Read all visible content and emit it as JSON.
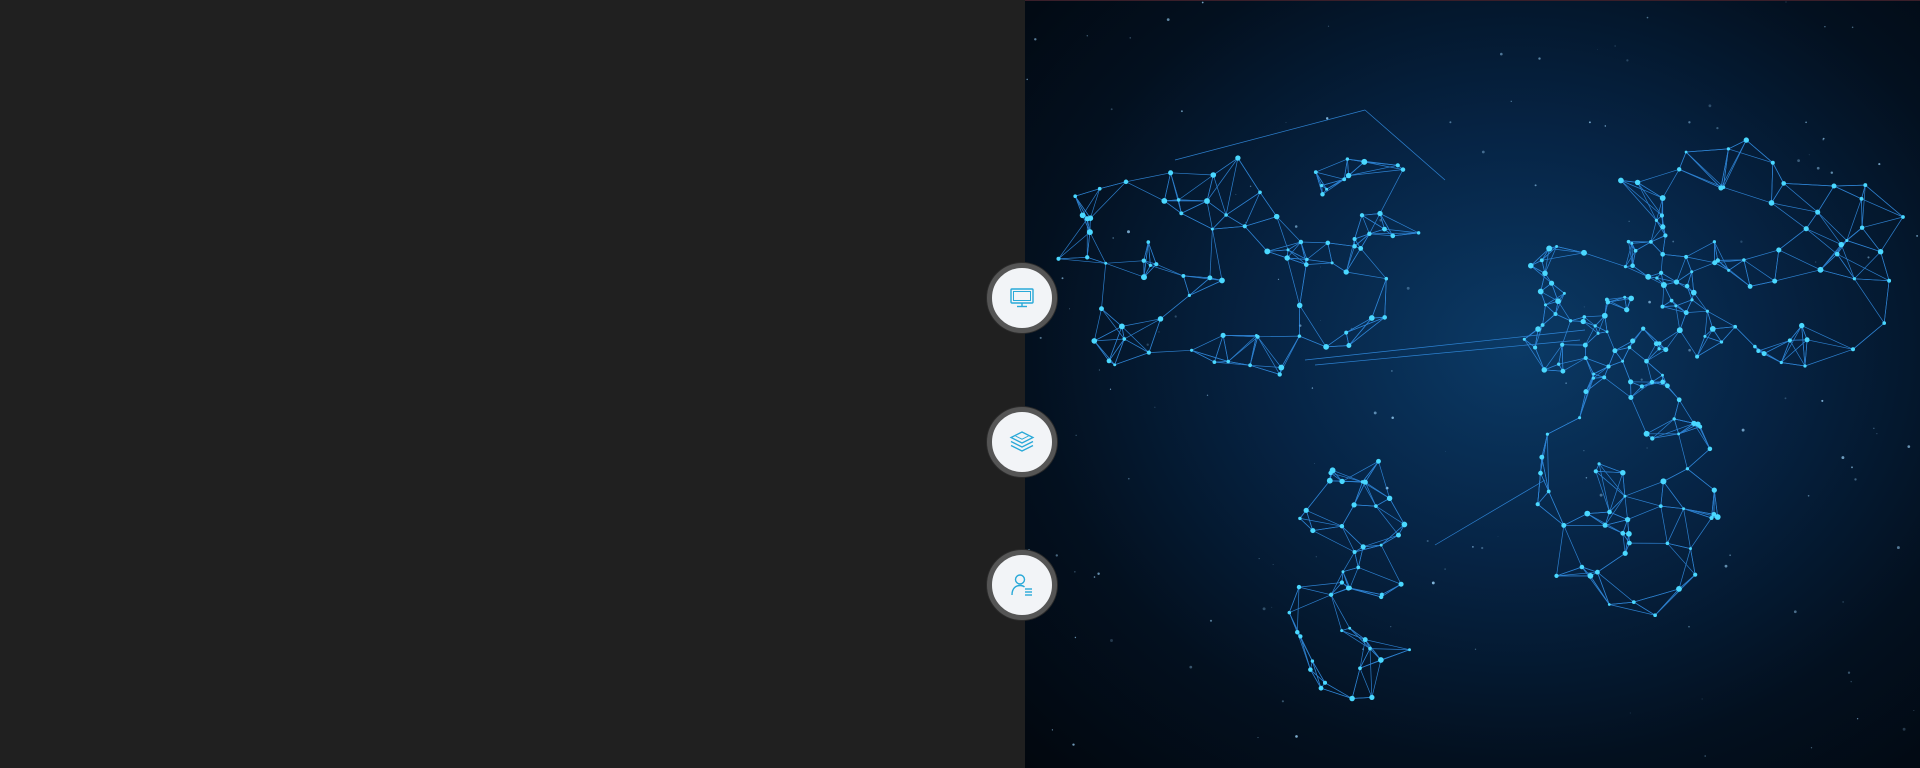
{
  "page": {
    "background": "#202020",
    "hero": {
      "description_icon": "world-network-map",
      "colors": {
        "space": "#03101f",
        "glow": "#0b3a66",
        "network_line": "#3aa0ff",
        "network_node": "#4ad8ff"
      }
    },
    "side_icons": [
      {
        "icon": "monitor-icon",
        "accent": "#29a9d8"
      },
      {
        "icon": "layers-icon",
        "accent": "#29a9d8"
      },
      {
        "icon": "user-list-icon",
        "accent": "#29a9d8"
      }
    ]
  }
}
